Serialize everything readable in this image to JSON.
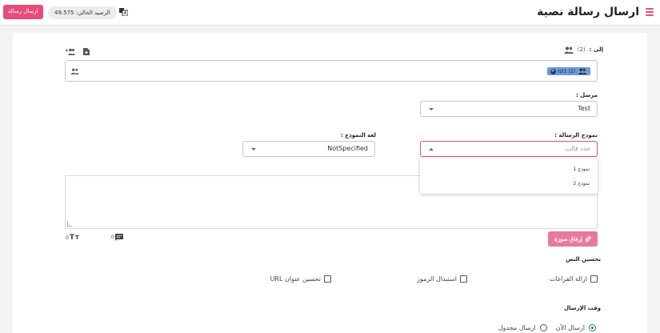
{
  "header": {
    "title": "ارسال رسالة نصية",
    "send_button": "ارسال رسالة",
    "balance": "الرصيد الحالي: 49.575"
  },
  "recipients": {
    "label": "إلى :",
    "count": "(2)",
    "chip_label": "Ist1 (2)"
  },
  "sender": {
    "label": "مرسل :",
    "value": "Test"
  },
  "template": {
    "label": "نموذج الرسالة :",
    "placeholder": "حدد قالب",
    "options": [
      "نموذج 1",
      "نموذج 2"
    ]
  },
  "template_language": {
    "label": "لغة النموذج :",
    "value": "NotSpecified"
  },
  "counters": {
    "characters": "0",
    "messages": "0"
  },
  "attach_button": "إرفاق صورة",
  "text_improve": {
    "label": "تحسين النص",
    "options": [
      "ازالة الفراغات",
      "استبدال الرموز",
      "تحسين عنوان URL"
    ]
  },
  "send_time": {
    "label": "وقت الإرسال",
    "options": [
      "ارسال الآن",
      "ارسال مجدول"
    ],
    "selected": "ارسال الآن"
  },
  "colors": {
    "accent": "#e84d7a",
    "chip": "#6b9bd8",
    "radio": "#2a7d5a"
  }
}
